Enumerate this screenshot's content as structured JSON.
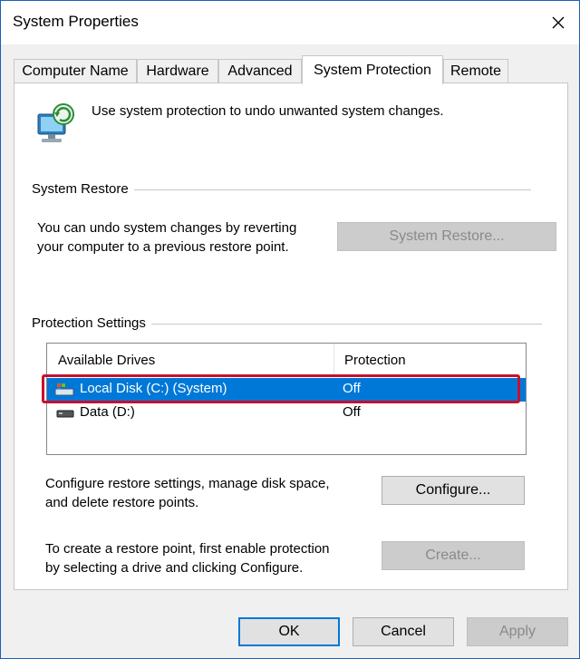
{
  "window": {
    "title": "System Properties"
  },
  "tabs": [
    {
      "label": "Computer Name"
    },
    {
      "label": "Hardware"
    },
    {
      "label": "Advanced"
    },
    {
      "label": "System Protection",
      "active": true
    },
    {
      "label": "Remote"
    }
  ],
  "intro": {
    "text": "Use system protection to undo unwanted system changes."
  },
  "system_restore": {
    "group_label": "System Restore",
    "description_line1": "You can undo system changes by reverting",
    "description_line2": "your computer to a previous restore point.",
    "button_label": "System Restore..."
  },
  "protection_settings": {
    "group_label": "Protection Settings",
    "columns": [
      "Available Drives",
      "Protection"
    ],
    "drives": [
      {
        "name": "Local Disk (C:) (System)",
        "protection": "Off",
        "selected": true
      },
      {
        "name": "Data (D:)",
        "protection": "Off",
        "selected": false
      }
    ],
    "configure_text_line1": "Configure restore settings, manage disk space,",
    "configure_text_line2": "and delete restore points.",
    "configure_button": "Configure...",
    "create_text_line1": "To create a restore point, first enable protection",
    "create_text_line2": "by selecting a drive and clicking Configure.",
    "create_button": "Create..."
  },
  "footer": {
    "ok": "OK",
    "cancel": "Cancel",
    "apply": "Apply"
  },
  "colors": {
    "selection": "#0078d7",
    "highlight_border": "#c8102e",
    "accent": "#0078d7"
  },
  "icons": [
    "system-protection-icon",
    "close-icon",
    "drive-icon-system",
    "drive-icon"
  ]
}
